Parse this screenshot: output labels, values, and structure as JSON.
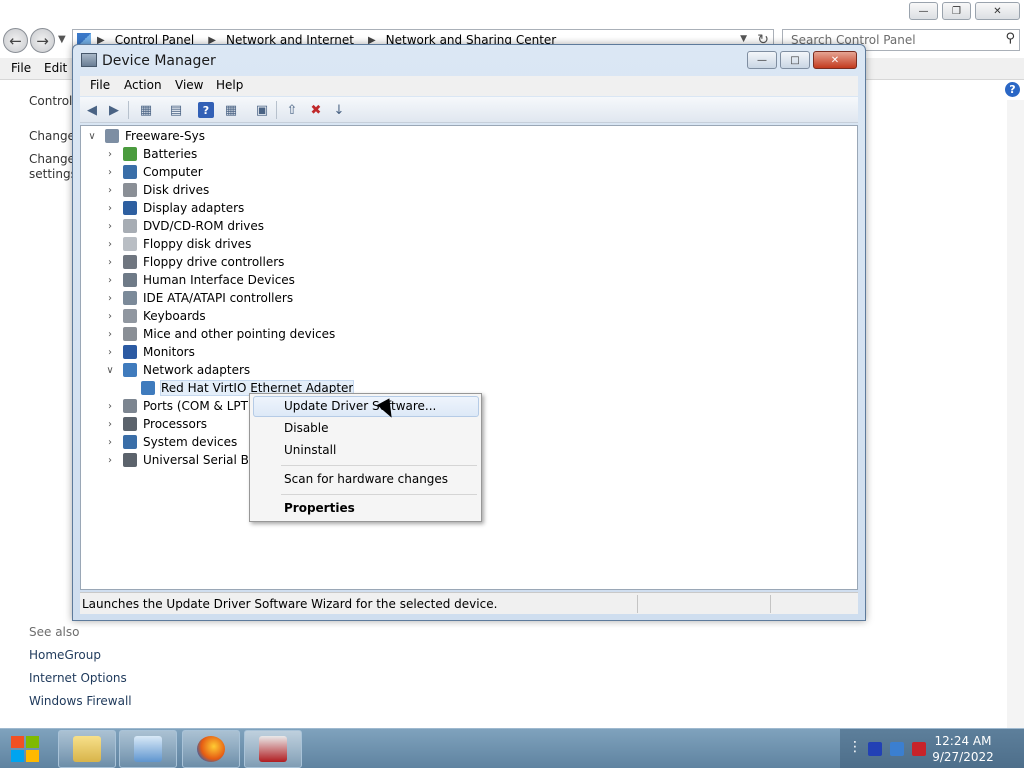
{
  "control_panel": {
    "address": [
      "Control Panel",
      "Network and Internet",
      "Network and Sharing Center"
    ],
    "search_placeholder": "Search Control Panel",
    "menu": [
      "File",
      "Edit"
    ],
    "side": [
      "Control",
      "Change",
      "Change",
      "settings"
    ],
    "see_also": "See also",
    "links": [
      "HomeGroup",
      "Internet Options",
      "Windows Firewall"
    ]
  },
  "device_manager": {
    "title": "Device Manager",
    "menu": [
      "File",
      "Action",
      "View",
      "Help"
    ],
    "root": "Freeware-Sys",
    "categories": [
      {
        "label": "Batteries",
        "color": "#4a9b3e",
        "expanded": false
      },
      {
        "label": "Computer",
        "color": "#3a6ea8",
        "expanded": false
      },
      {
        "label": "Disk drives",
        "color": "#8a8f96",
        "expanded": false
      },
      {
        "label": "Display adapters",
        "color": "#2e5fa0",
        "expanded": false
      },
      {
        "label": "DVD/CD-ROM drives",
        "color": "#a7adb4",
        "expanded": false
      },
      {
        "label": "Floppy disk drives",
        "color": "#b9bec4",
        "expanded": false
      },
      {
        "label": "Floppy drive controllers",
        "color": "#6f7680",
        "expanded": false
      },
      {
        "label": "Human Interface Devices",
        "color": "#6e7a87",
        "expanded": false
      },
      {
        "label": "IDE ATA/ATAPI controllers",
        "color": "#7b8a99",
        "expanded": false
      },
      {
        "label": "Keyboards",
        "color": "#9097a0",
        "expanded": false
      },
      {
        "label": "Mice and other pointing devices",
        "color": "#8a8f96",
        "expanded": false
      },
      {
        "label": "Monitors",
        "color": "#2b5aa3",
        "expanded": false
      },
      {
        "label": "Network adapters",
        "color": "#3f7bbd",
        "expanded": true
      },
      {
        "label": "Ports (COM & LPT)",
        "color": "#7c8590",
        "expanded": false
      },
      {
        "label": "Processors",
        "color": "#5b636c",
        "expanded": false
      },
      {
        "label": "System devices",
        "color": "#3a6ea8",
        "expanded": false
      },
      {
        "label": "Universal Serial Bus c",
        "color": "#5b636c",
        "expanded": false
      }
    ],
    "child_device": "Red Hat VirtIO Ethernet Adapter",
    "status_text": "Launches the Update Driver Software Wizard for the selected device."
  },
  "context_menu": {
    "update": "Update Driver Software...",
    "disable": "Disable",
    "uninstall": "Uninstall",
    "scan": "Scan for hardware changes",
    "properties": "Properties"
  },
  "taskbar": {
    "time": "12:24 AM",
    "date": "9/27/2022"
  },
  "colors": {
    "accent": "#3f7bbd",
    "close_red": "#c33a1e"
  }
}
